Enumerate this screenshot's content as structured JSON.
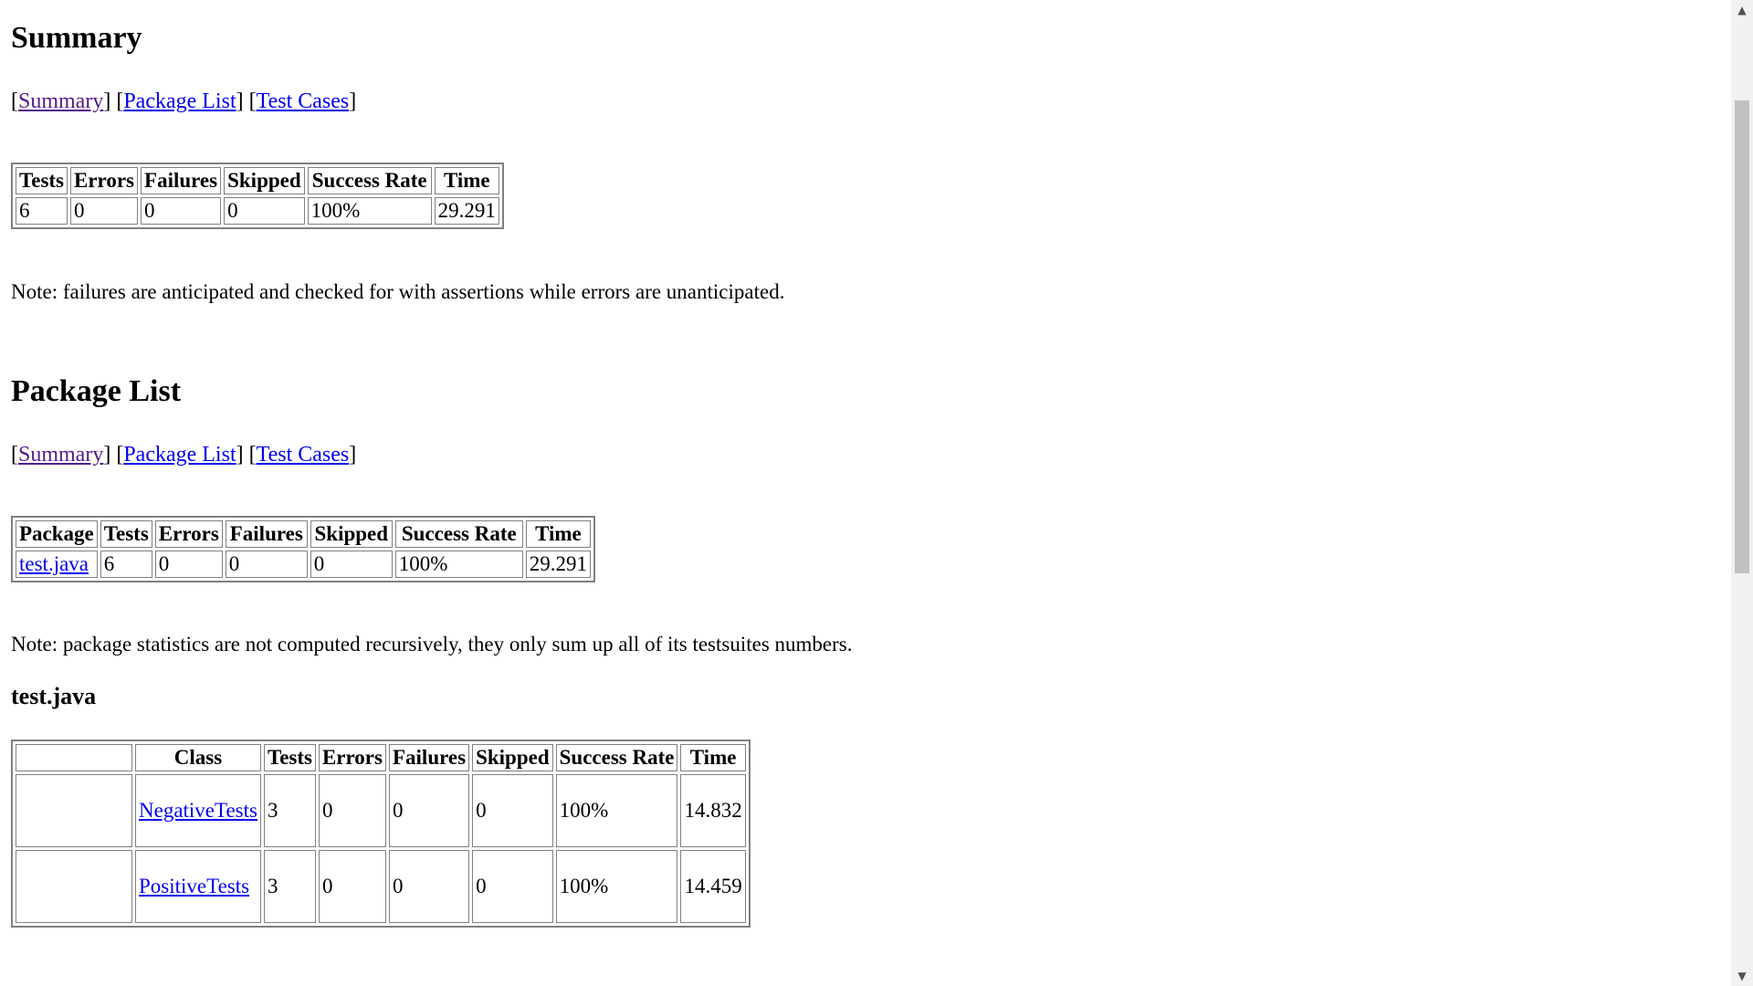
{
  "summary": {
    "heading": "Summary",
    "nav": [
      "Summary",
      "Package List",
      "Test Cases"
    ],
    "columns": [
      "Tests",
      "Errors",
      "Failures",
      "Skipped",
      "Success Rate",
      "Time"
    ],
    "row": [
      "6",
      "0",
      "0",
      "0",
      "100%",
      "29.291"
    ],
    "note": "Note: failures are anticipated and checked for with assertions while errors are unanticipated."
  },
  "package_list": {
    "heading": "Package List",
    "nav": [
      "Summary",
      "Package List",
      "Test Cases"
    ],
    "columns": [
      "Package",
      "Tests",
      "Errors",
      "Failures",
      "Skipped",
      "Success Rate",
      "Time"
    ],
    "row": [
      "test.java",
      "6",
      "0",
      "0",
      "0",
      "100%",
      "29.291"
    ],
    "note": "Note: package statistics are not computed recursively, they only sum up all of its testsuites numbers."
  },
  "package_detail": {
    "heading": "test.java",
    "columns": [
      "",
      "Class",
      "Tests",
      "Errors",
      "Failures",
      "Skipped",
      "Success Rate",
      "Time"
    ],
    "rows": [
      [
        "",
        "NegativeTests",
        "3",
        "0",
        "0",
        "0",
        "100%",
        "14.832"
      ],
      [
        "",
        "PositiveTests",
        "3",
        "0",
        "0",
        "0",
        "100%",
        "14.459"
      ]
    ]
  },
  "scrollbar": {
    "up_icon": "triangle-up",
    "down_icon": "triangle-down"
  }
}
